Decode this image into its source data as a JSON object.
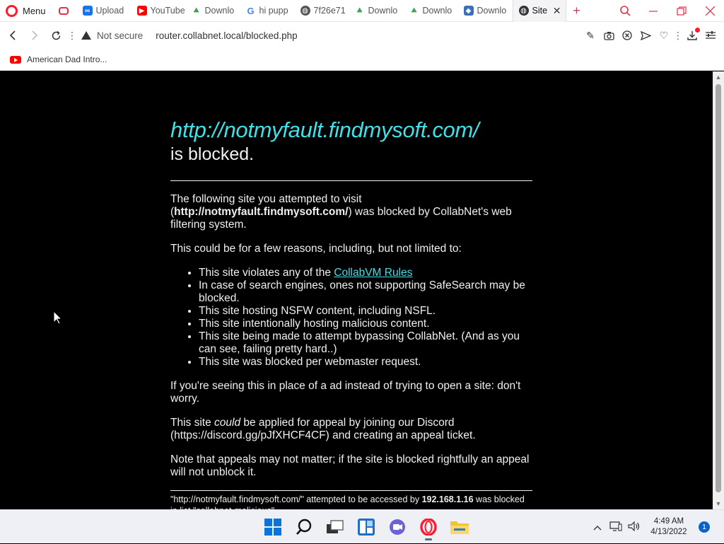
{
  "browser": {
    "menu_label": "Menu",
    "tabs": [
      {
        "label": "",
        "icon": "gamepad-icon",
        "color": "#e0304a"
      },
      {
        "label": "Upload",
        "icon": "infinity-icon",
        "color": "#1a73e8"
      },
      {
        "label": "YouTube",
        "icon": "youtube-icon",
        "color": "#ff0000"
      },
      {
        "label": "Downlo",
        "icon": "download-leaf-icon",
        "color": "#3aa64a"
      },
      {
        "label": "hi pupp",
        "icon": "google-icon",
        "color": "#4285f4"
      },
      {
        "label": "7f26e71",
        "icon": "globe-icon",
        "color": "#555555"
      },
      {
        "label": "Downlo",
        "icon": "download-leaf-icon",
        "color": "#3aa64a"
      },
      {
        "label": "Downlo",
        "icon": "download-leaf-icon",
        "color": "#3aa64a"
      },
      {
        "label": "Downlo",
        "icon": "cube-icon",
        "color": "#3b6fb6"
      },
      {
        "label": "Site",
        "icon": "globe-icon",
        "color": "#333333",
        "active": true
      }
    ],
    "new_tab": "+",
    "window_controls": [
      "search",
      "minimize",
      "restore",
      "close"
    ]
  },
  "address": {
    "security_label": "Not secure",
    "url": "router.collabnet.local/blocked.php"
  },
  "bookmarks": [
    {
      "label": "American Dad Intro...",
      "icon": "youtube-icon"
    }
  ],
  "page": {
    "blocked_url": "http://notmyfault.findmysoft.com/",
    "blocked_suffix": "is blocked.",
    "intro_1": "The following site you attempted to visit (",
    "intro_url": "http://notmyfault.findmysoft.com/",
    "intro_2": ") was blocked by CollabNet's web filtering system.",
    "reasons_intro": "This could be for a few reasons, including, but not limited to:",
    "reason_1_pre": "This site violates any of the ",
    "rules_link": "CollabVM Rules",
    "reasons": [
      "In case of search engines, ones not supporting SafeSearch may be blocked.",
      "This site hosting NSFW content, including NSFL.",
      "This site intentionally hosting malicious content.",
      "This site being made to attempt bypassing CollabNet. (And as you can see, failing pretty hard..)",
      "This site was blocked per webmaster request."
    ],
    "ad_note": "If you're seeing this in place of a ad instead of trying to open a site: don't worry.",
    "appeal_pre": "This site ",
    "appeal_em": "could",
    "appeal_post": " be applied for appeal by joining our Discord (https://discord.gg/pJfXHCF4CF) and creating an appeal ticket.",
    "appeal_note": "Note that appeals may not matter; if the site is blocked rightfully an appeal will not unblock it.",
    "footer_1": "\"http://notmyfault.findmysoft.com/\" attempted to be accessed by ",
    "footer_ip": "192.168.1.16",
    "footer_2": " was blocked in list \"collabnet-malicious\""
  },
  "taskbar": {
    "apps": [
      "windows-start-icon",
      "search-icon",
      "task-view-icon",
      "widgets-icon",
      "teams-chat-icon",
      "opera-icon",
      "file-explorer-icon"
    ],
    "time": "4:49 AM",
    "date": "4/13/2022",
    "notifications": "1"
  },
  "colors": {
    "link_cyan": "#3fe0e8",
    "opera_red": "#ff1b2d",
    "page_bg": "#000000"
  }
}
